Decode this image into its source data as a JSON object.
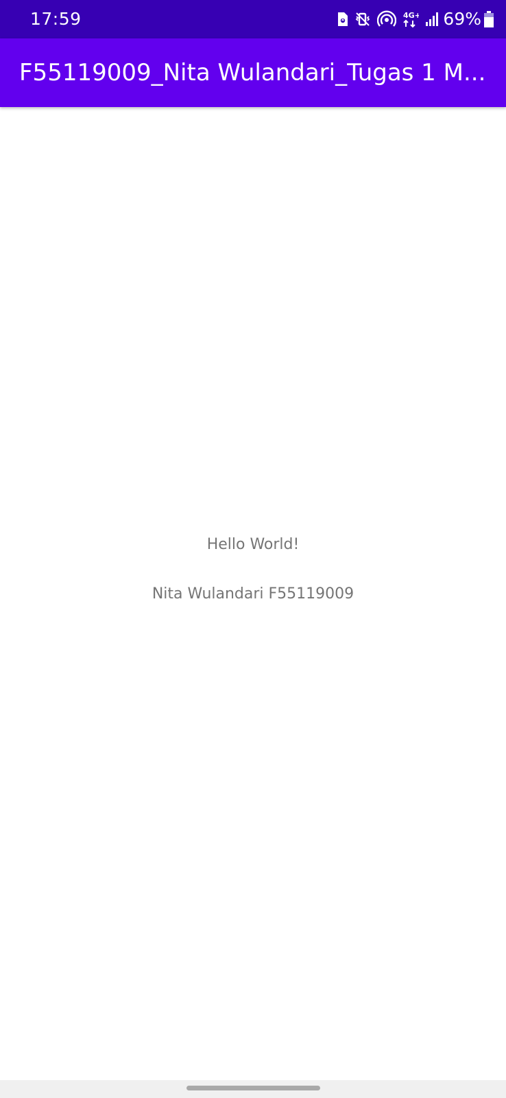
{
  "status_bar": {
    "time": "17:59",
    "network_label": "4G+",
    "battery_percent": "69%",
    "icons": [
      "sim-card-icon",
      "vibrate-mute-icon",
      "hotspot-icon",
      "network-4g-icon",
      "signal-icon",
      "battery-icon"
    ],
    "background_color": "#3700b3"
  },
  "app_bar": {
    "title": "F55119009_Nita Wulandari_Tugas 1 M...",
    "background_color": "#6200ee"
  },
  "content": {
    "hello_text": "Hello World!",
    "name_text": "Nita Wulandari F55119009"
  }
}
